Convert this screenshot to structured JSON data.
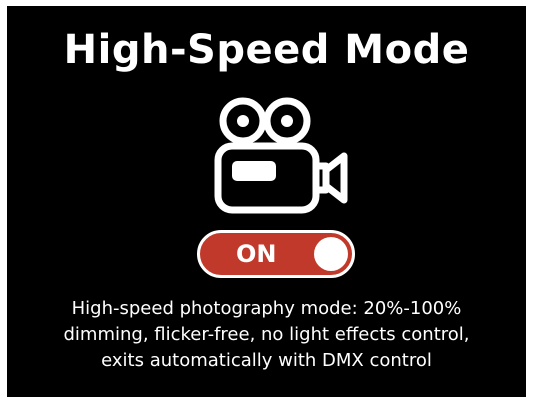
{
  "screen": {
    "title": "High-Speed Mode",
    "icon": "movie-camera-icon",
    "toggle": {
      "label": "ON",
      "state": "on",
      "active_color": "#c0392b"
    },
    "description": {
      "line1": "High-speed photography mode: 20%-100%",
      "line2": "dimming, flicker-free, no light effects control,",
      "line3": "exits automatically with DMX control"
    },
    "background_color": "#000000"
  }
}
